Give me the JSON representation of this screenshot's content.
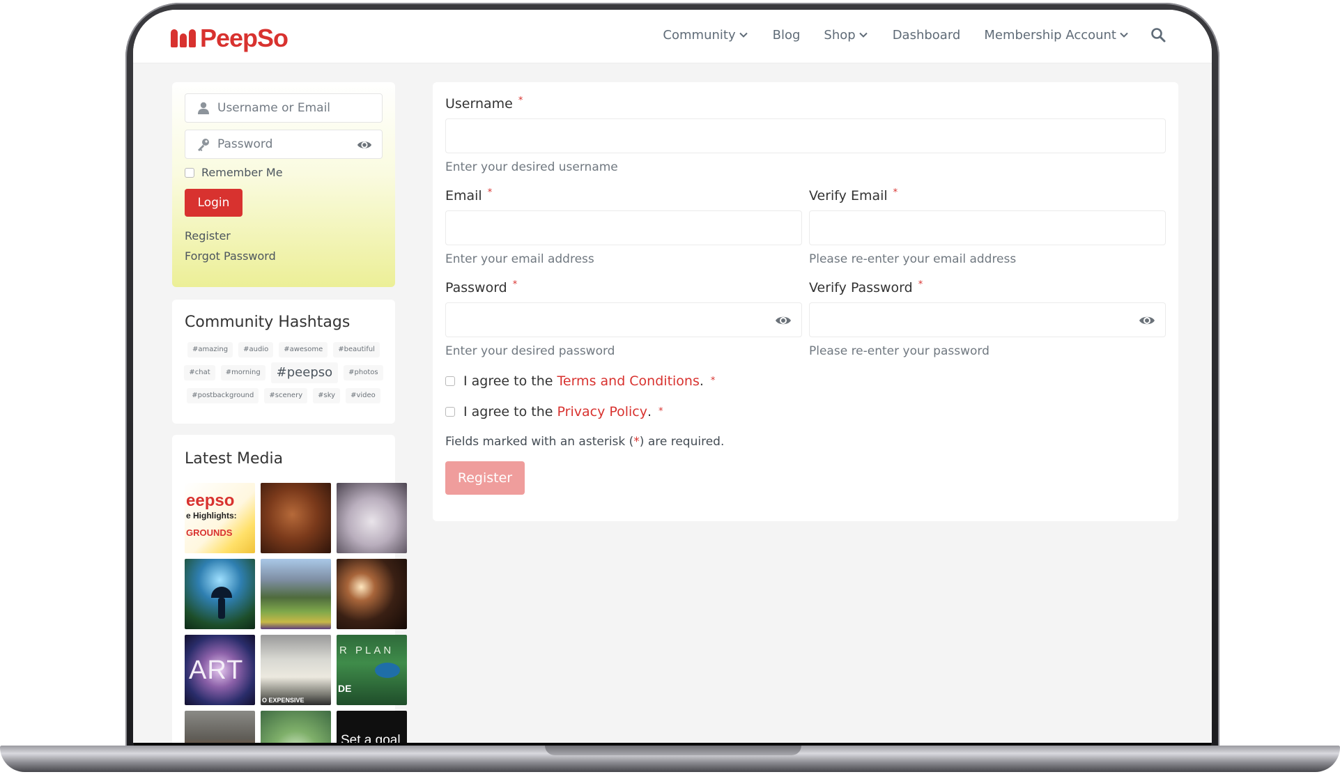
{
  "header": {
    "logo_text": "PeepSo",
    "nav": [
      {
        "label": "Community",
        "has_dropdown": true
      },
      {
        "label": "Blog",
        "has_dropdown": false
      },
      {
        "label": "Shop",
        "has_dropdown": true
      },
      {
        "label": "Dashboard",
        "has_dropdown": false
      },
      {
        "label": "Membership Account",
        "has_dropdown": true
      }
    ],
    "search_icon": "search-icon"
  },
  "login_widget": {
    "username_placeholder": "Username or Email",
    "password_placeholder": "Password",
    "remember_label": "Remember Me",
    "remember_checked": false,
    "login_label": "Login",
    "register_link": "Register",
    "forgot_link": "Forgot Password"
  },
  "hashtags": {
    "title": "Community Hashtags",
    "tags": [
      "#amazing",
      "#audio",
      "#awesome",
      "#beautiful",
      "#chat",
      "#morning",
      "#peepso",
      "#photos",
      "#postbackground",
      "#scenery",
      "#sky",
      "#video"
    ]
  },
  "media": {
    "title": "Latest Media",
    "thumb1": {
      "line1": "eepso",
      "line2": "e Highlights:",
      "line3": "GROUNDS"
    },
    "thumb7_text": "ART",
    "thumb8_text": "O EXPENSIVE",
    "thumb9": {
      "top": "R PLAN",
      "bottom": "DE"
    },
    "thumb12_text": "Set a goal"
  },
  "form": {
    "username_label": "Username",
    "username_hint": "Enter your desired username",
    "email_label": "Email",
    "email_hint": "Enter your email address",
    "verify_email_label": "Verify Email",
    "verify_email_hint": "Please re-enter your email address",
    "password_label": "Password",
    "password_hint": "Enter your desired password",
    "verify_password_label": "Verify Password",
    "verify_password_hint": "Please re-enter your password",
    "required_star": "*",
    "terms_prefix": "I agree to the",
    "terms_link": "Terms and Conditions",
    "privacy_prefix": "I agree to the",
    "privacy_link": "Privacy Policy",
    "period": ".",
    "required_note_before": "Fields marked with an asterisk (",
    "required_note_after": ") are required.",
    "register_label": "Register"
  },
  "colors": {
    "brand": "#d8322f",
    "register_button": "#ef9d9c",
    "login_gradient_end": "#ecef97"
  }
}
